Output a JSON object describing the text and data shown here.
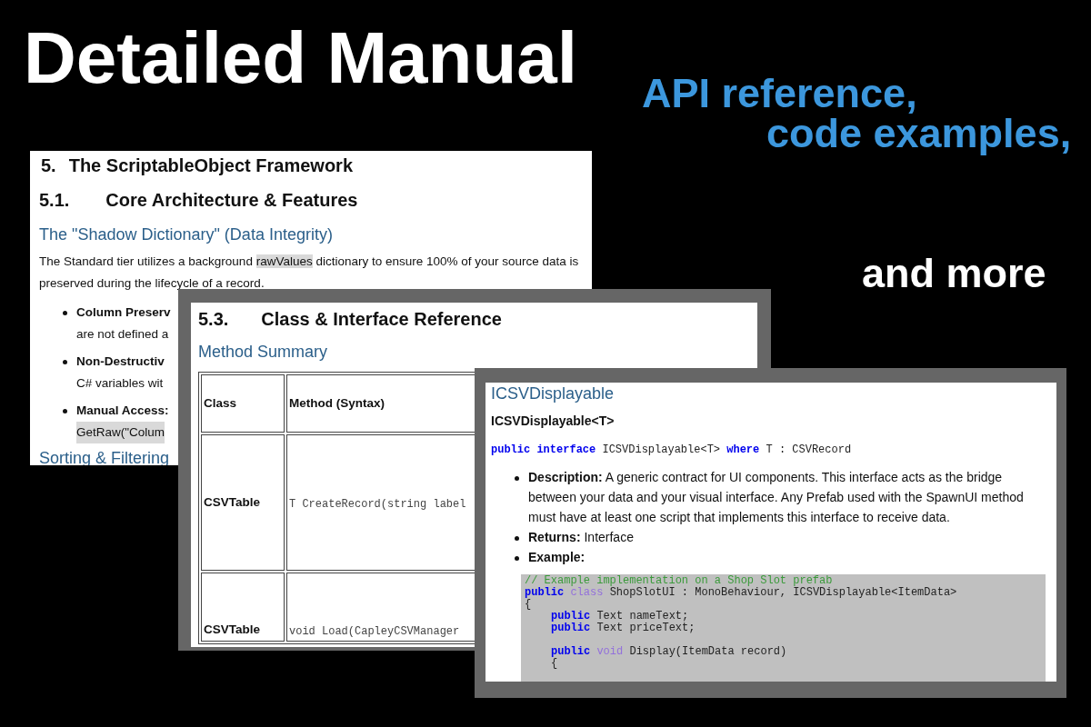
{
  "headline": "Detailed Manual",
  "taglines": [
    {
      "text": "API reference,",
      "kind": "blue"
    },
    {
      "text": "code examples,",
      "kind": "blue"
    },
    {
      "text": "and more",
      "kind": "white"
    }
  ],
  "page_1": {
    "chapter": {
      "number": "5.",
      "title": "The ScriptableObject Framework"
    },
    "section": {
      "number": "5.1.",
      "title": "Core Architecture & Features"
    },
    "subheading": "The \"Shadow Dictionary\" (Data Integrity)",
    "paragraph": [
      {
        "text": "The Standard tier utilizes a background ",
        "highlight": false
      },
      {
        "text": "rawValues",
        "highlight": true
      },
      {
        "text": " dictionary to ensure 100% of your source data is preserved during the lifecycle of a record.",
        "highlight": false
      }
    ],
    "bullets": [
      {
        "lead": "Column Preserv",
        "rest": "are not defined a",
        "rest_highlight": false
      },
      {
        "lead": "Non-Destructiv",
        "rest": "C# variables wit",
        "rest_highlight": false
      },
      {
        "lead": "Manual Access:",
        "rest": "GetRaw(\"Colum",
        "rest_highlight": true
      }
    ],
    "next_subheading": "Sorting & Filtering"
  },
  "page_2": {
    "section": {
      "number": "5.3.",
      "title": "Class & Interface Reference"
    },
    "subheading": "Method Summary",
    "table": {
      "columns": [
        "Class",
        "Method (Syntax)"
      ],
      "rows": [
        [
          "CSVTable",
          "T CreateRecord(string label"
        ],
        [
          "CSVTable",
          "void Load(CapleyCSVManager"
        ]
      ]
    }
  },
  "page_3": {
    "subheading": "ICSVDisplayable",
    "signature_title": "ICSVDisplayable<T>",
    "declaration": [
      {
        "text": "public",
        "kind": "keyword"
      },
      {
        "text": "interface",
        "kind": "keyword"
      },
      {
        "text": "ICSVDisplayable<T>",
        "kind": "plain"
      },
      {
        "text": "where",
        "kind": "keyword"
      },
      {
        "text": "T : CSVRecord",
        "kind": "plain"
      }
    ],
    "bullets": [
      "**Description:** A generic contract for UI components. This interface acts as the bridge between your data and your visual interface. Any Prefab used with the SpawnUI method must have at least one script that implements this interface to receive data.",
      "**Returns:** Interface",
      "**Example:**"
    ],
    "code": [
      {
        "segments": [
          {
            "text": "// Example implementation on a Shop Slot prefab",
            "kind": "comment"
          }
        ]
      },
      {
        "segments": [
          {
            "text": "public",
            "kind": "keyword"
          },
          {
            "text": "class",
            "kind": "type"
          },
          {
            "text": "ShopSlotUI : MonoBehaviour, ICSVDisplayable<ItemData>",
            "kind": "plain"
          }
        ]
      },
      {
        "segments": [
          {
            "text": "{",
            "kind": "plain"
          }
        ]
      },
      {
        "indent": true,
        "segments": [
          {
            "text": "public",
            "kind": "keyword"
          },
          {
            "text": "Text nameText;",
            "kind": "plain"
          }
        ]
      },
      {
        "indent": true,
        "segments": [
          {
            "text": "public",
            "kind": "keyword"
          },
          {
            "text": "Text priceText;",
            "kind": "plain"
          }
        ]
      },
      {
        "indent": true,
        "space_before": true,
        "segments": [
          {
            "text": "public",
            "kind": "keyword"
          },
          {
            "text": "void",
            "kind": "type"
          },
          {
            "text": "Display(ItemData record)",
            "kind": "plain"
          }
        ]
      },
      {
        "indent": true,
        "segments": [
          {
            "text": "{",
            "kind": "plain"
          }
        ]
      }
    ]
  }
}
